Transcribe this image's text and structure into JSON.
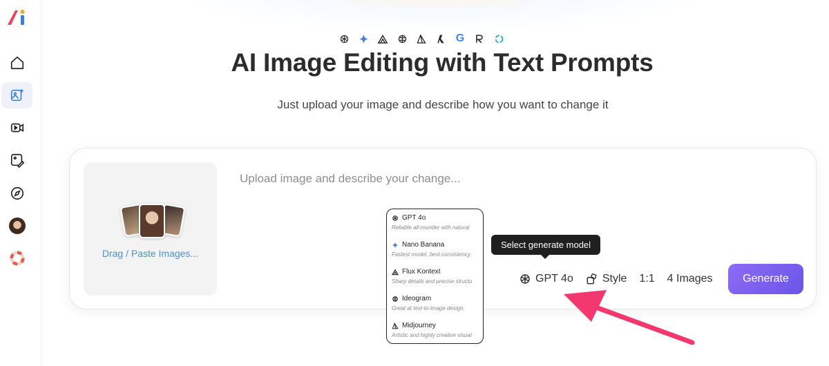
{
  "sidebar": {
    "logo_text": "Ai",
    "items": [
      {
        "name": "home",
        "icon": "home-icon",
        "active": false
      },
      {
        "name": "image-edit",
        "icon": "image-sparkle-icon",
        "active": true
      },
      {
        "name": "video",
        "icon": "video-icon",
        "active": false
      },
      {
        "name": "image-edit-pen",
        "icon": "image-pen-icon",
        "active": false
      },
      {
        "name": "explore",
        "icon": "compass-icon",
        "active": false
      },
      {
        "name": "profile",
        "icon": "avatar",
        "active": false
      },
      {
        "name": "help",
        "icon": "lifebuoy-icon",
        "active": false
      }
    ]
  },
  "header": {
    "model_logos": [
      "openai-icon",
      "gemini-icon",
      "flux-icon",
      "ideogram-icon",
      "midjourney-icon",
      "recraft-icon",
      "google-icon",
      "reve-icon",
      "qwen-icon"
    ],
    "title": "AI Image Editing with Text Prompts",
    "subtitle": "Just upload your image and describe how you want to change it"
  },
  "editor": {
    "upload_label": "Drag / Paste Images...",
    "prompt_placeholder": "Upload image and describe your change...",
    "model_label": "GPT 4o",
    "style_label": "Style",
    "ratio_label": "1:1",
    "count_label": "4 Images",
    "generate_label": "Generate"
  },
  "tooltip": {
    "text": "Select generate model"
  },
  "model_menu": {
    "items": [
      {
        "name": "GPT 4o",
        "desc": "Reliable all-rounder with natural",
        "icon": "openai-icon"
      },
      {
        "name": "Nano Banana",
        "desc": "Fastest model, best consistency.",
        "icon": "gemini-icon"
      },
      {
        "name": "Flux Kontext",
        "desc": "Sharp details and precise structu",
        "icon": "flux-icon"
      },
      {
        "name": "Ideogram",
        "desc": "Great at text-to-image design.",
        "icon": "ideogram-icon"
      },
      {
        "name": "Midjourney",
        "desc": "Artistic and highly creative visual",
        "icon": "midjourney-icon"
      }
    ]
  },
  "colors": {
    "accent": "#7b61f0",
    "upload_link": "#4a8fd4",
    "annotation_arrow": "#f2386e",
    "tooltip_bg": "#1f1f1f"
  }
}
